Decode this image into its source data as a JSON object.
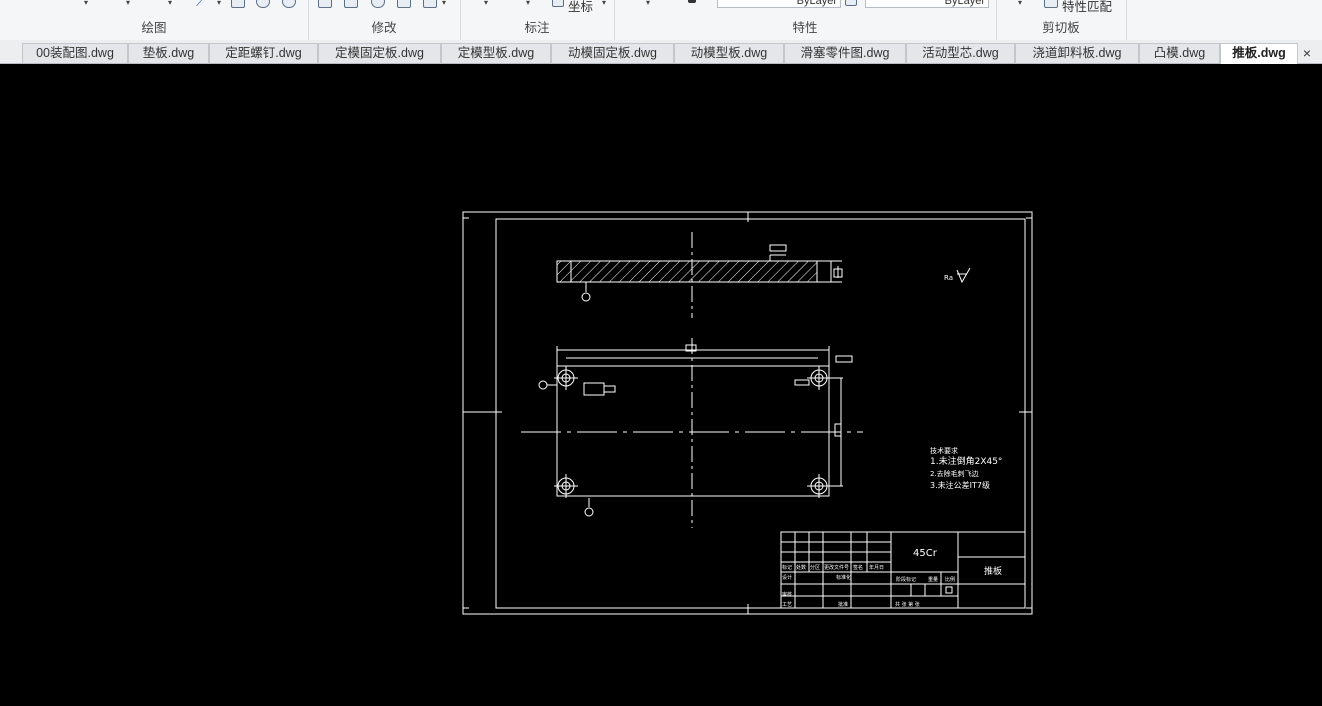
{
  "ribbon": {
    "panels": {
      "draw": "绘图",
      "modify": "修改",
      "annotate": "标注",
      "properties": "特性",
      "clipboard": "剪切板"
    },
    "coordinate_label": "坐标",
    "layer_combo_1": "ByLayer",
    "layer_combo_2": "ByLayer",
    "match_properties_label": "特性匹配"
  },
  "tabs": [
    {
      "label": "00装配图.dwg"
    },
    {
      "label": "垫板.dwg"
    },
    {
      "label": "定距螺钉.dwg"
    },
    {
      "label": "定模固定板.dwg"
    },
    {
      "label": "定模型板.dwg"
    },
    {
      "label": "动模固定板.dwg"
    },
    {
      "label": "动模型板.dwg"
    },
    {
      "label": "滑塞零件图.dwg"
    },
    {
      "label": "活动型芯.dwg"
    },
    {
      "label": "浇道卸料板.dwg"
    },
    {
      "label": "凸模.dwg"
    },
    {
      "label": "推板.dwg"
    }
  ],
  "active_tab": "推板.dwg",
  "close_glyph": "×",
  "drawing": {
    "surface_label": "Ra",
    "notes_title": "技术要求",
    "notes": [
      "1.未注倒角2X45°",
      "2.去除毛刺飞边",
      "3.未注公差IT7级"
    ],
    "title_block": {
      "material": "45Cr",
      "part_name": "推板",
      "labels": [
        "标记",
        "处数",
        "分区",
        "更改文件号",
        "签名",
        "年月日",
        "设计",
        "标准化",
        "阶段标记",
        "重量",
        "比例",
        "审核",
        "工艺",
        "批准"
      ],
      "sheet": "共  张  第  张"
    }
  },
  "colors": {
    "canvas": "#000000",
    "linework": "#ffffff",
    "ribbon": "#f5f6f7",
    "active_tab": "#ffffff"
  }
}
